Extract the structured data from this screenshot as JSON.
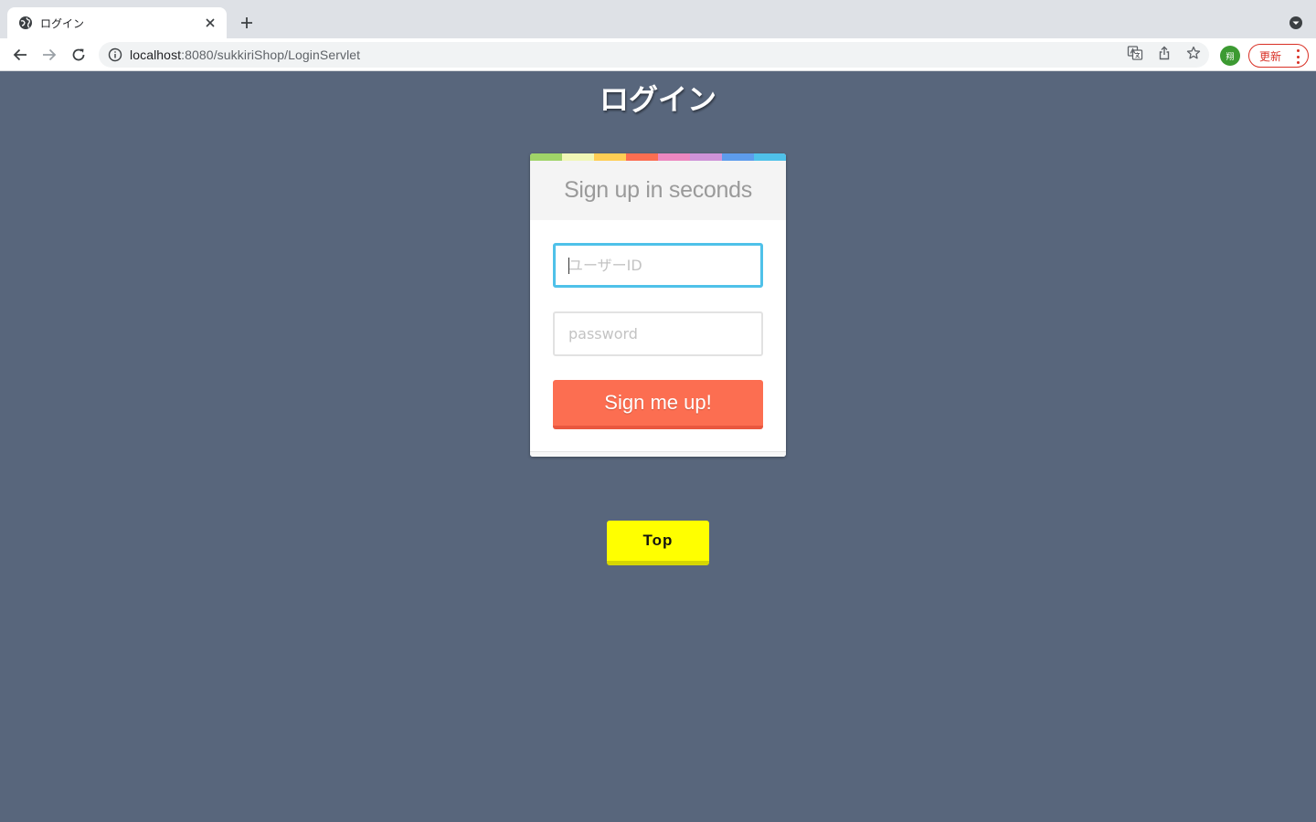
{
  "browser": {
    "tab_title": "ログイン",
    "url_host": "localhost",
    "url_rest": ":8080/sukkiriShop/LoginServlet",
    "profile_initial": "翔",
    "update_label": "更新"
  },
  "page": {
    "title": "ログイン"
  },
  "form": {
    "heading": "Sign up in seconds",
    "userid_placeholder": "ユーザーID",
    "userid_value": "",
    "password_placeholder": "password",
    "password_value": "",
    "submit_label": "Sign me up!",
    "stripe_colors": [
      "#a0d468",
      "#f0f7b6",
      "#ffce54",
      "#fc6e51",
      "#ec87c0",
      "#ce93d8",
      "#5d9cec",
      "#4fc1e9"
    ]
  },
  "top_button": {
    "label": "Top"
  },
  "colors": {
    "background": "#58667c",
    "accent_focus": "#4fc1e9",
    "submit": "#fc6e51",
    "top_button": "#ffff00"
  }
}
